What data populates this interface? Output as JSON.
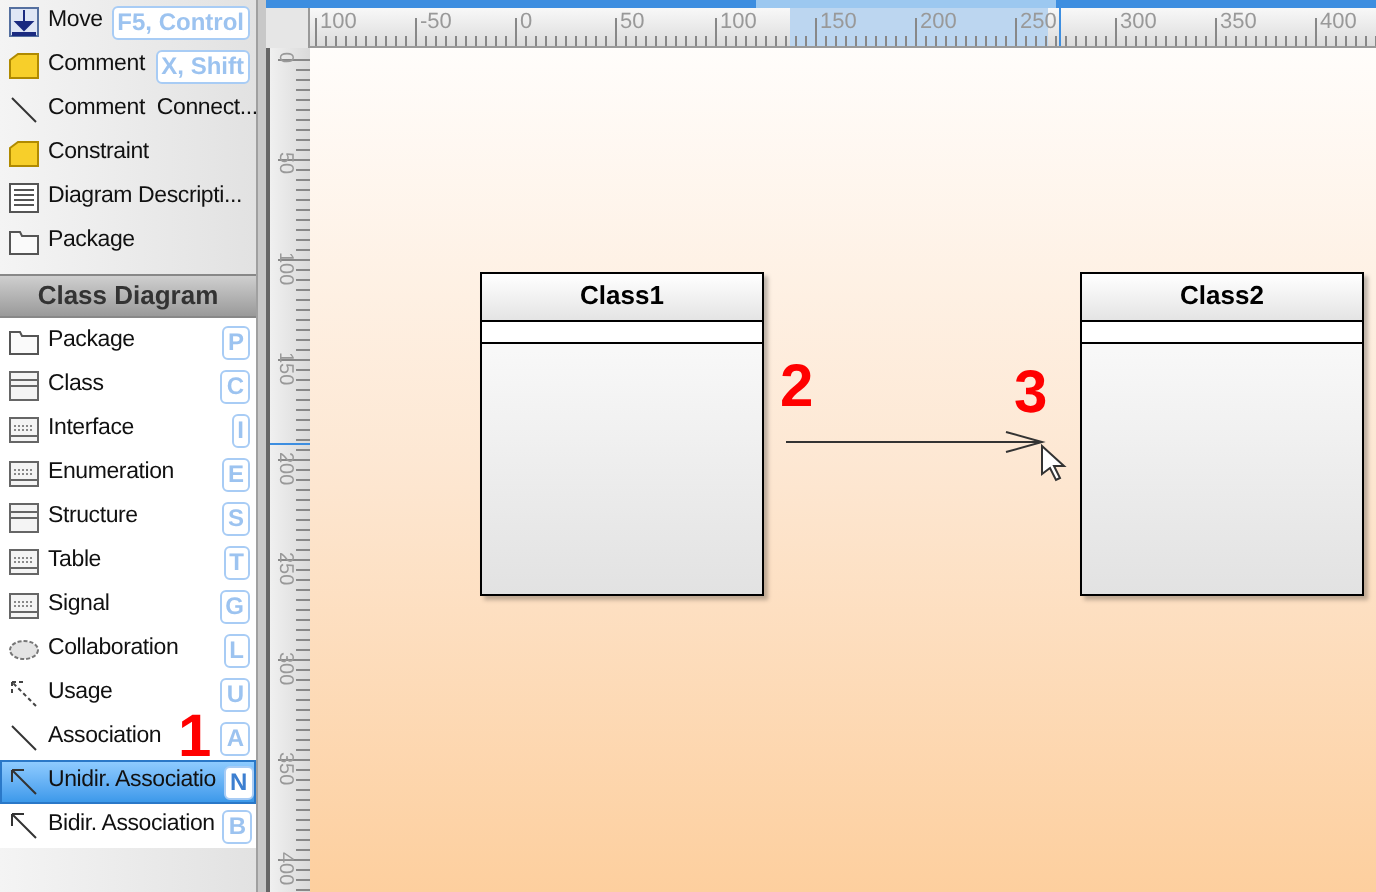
{
  "toolbox": {
    "sections": [
      {
        "kind": "plain",
        "items": [
          {
            "kind": "move",
            "label": "Move",
            "shortcut": "F5, Control",
            "selected": false
          },
          {
            "kind": "note",
            "label": "Comment",
            "shortcut": "X, Shift",
            "selected": false
          },
          {
            "kind": "line",
            "label": "Comment  Connect...",
            "selected": false
          },
          {
            "kind": "note",
            "label": "Constraint",
            "selected": false
          },
          {
            "kind": "lines",
            "label": "Diagram Descripti...",
            "selected": false
          },
          {
            "kind": "folder",
            "label": "Package",
            "selected": false
          }
        ]
      },
      {
        "kind": "group",
        "title": "Class Diagram",
        "items": [
          {
            "kind": "folder",
            "label": "Package",
            "shortcut": "P",
            "selected": false
          },
          {
            "kind": "class",
            "label": "Class",
            "shortcut": "C",
            "selected": false
          },
          {
            "kind": "stereo",
            "label": "Interface",
            "shortcut": "I",
            "selected": false
          },
          {
            "kind": "stereo",
            "label": "Enumeration",
            "shortcut": "E",
            "selected": false
          },
          {
            "kind": "class",
            "label": "Structure",
            "shortcut": "S",
            "selected": false
          },
          {
            "kind": "stereo",
            "label": "Table",
            "shortcut": "T",
            "selected": false
          },
          {
            "kind": "stereo",
            "label": "Signal",
            "shortcut": "G",
            "selected": false
          },
          {
            "kind": "ellipse",
            "label": "Collaboration",
            "shortcut": "L",
            "selected": false
          },
          {
            "kind": "dashed",
            "label": "Usage",
            "shortcut": "U",
            "selected": false
          },
          {
            "kind": "line",
            "label": "Association",
            "shortcut": "A",
            "selected": false
          },
          {
            "kind": "arrow",
            "label": "Unidir. Associatio",
            "shortcut": "N",
            "selected": true
          },
          {
            "kind": "arrow",
            "label": "Bidir. Association",
            "shortcut": "B",
            "selected": false
          }
        ]
      }
    ]
  },
  "horizontal_ruler": {
    "labels": [
      "100",
      "-50",
      "0",
      "50",
      "100",
      "150",
      "200",
      "250",
      "300",
      "350",
      "400"
    ]
  },
  "vertical_ruler": {
    "labels": [
      "0",
      "50",
      "100",
      "150",
      "200",
      "250",
      "300",
      "350",
      "400"
    ]
  },
  "diagram": {
    "classes": [
      {
        "name": "Class1"
      },
      {
        "name": "Class2"
      }
    ]
  },
  "step_markers": [
    "1",
    "2",
    "3"
  ]
}
